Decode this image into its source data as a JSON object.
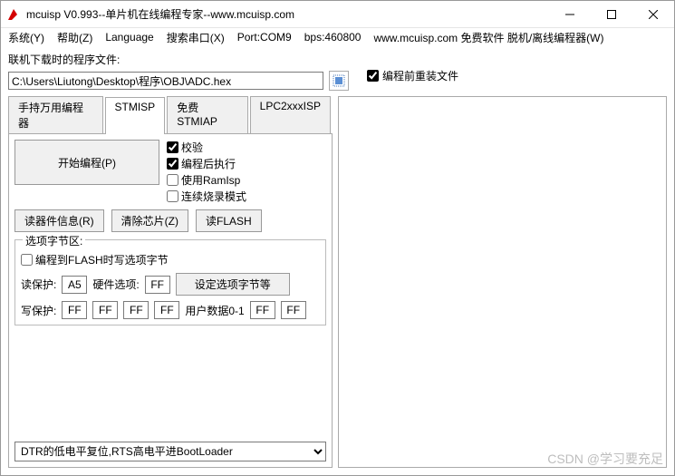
{
  "title": "mcuisp V0.993--单片机在线编程专家--www.mcuisp.com",
  "menu": {
    "system": "系统(Y)",
    "help": "帮助(Z)",
    "language": "Language",
    "search_port": "搜索串口(X)",
    "port": "Port:COM9",
    "bps": "bps:460800",
    "site": "www.mcuisp.com 免费软件 脱机/离线编程器(W)"
  },
  "path_label": "联机下载时的程序文件:",
  "path_value": "C:\\Users\\Liutong\\Desktop\\程序\\OBJ\\ADC.hex",
  "reload_label": "编程前重装文件",
  "tabs": {
    "t0": "手持万用编程器",
    "t1": "STMISP",
    "t2": "免费STMIAP",
    "t3": "LPC2xxxISP"
  },
  "btn_program": "开始编程(P)",
  "checks": {
    "verify": "校验",
    "run_after": "编程后执行",
    "ramisp": "使用RamIsp",
    "continuous": "连续烧录模式"
  },
  "btns": {
    "chip_info": "读器件信息(R)",
    "erase": "清除芯片(Z)",
    "read_flash": "读FLASH"
  },
  "opt": {
    "group_title": "选项字节区:",
    "write_opt": "编程到FLASH时写选项字节",
    "read_protect": "读保护:",
    "hw_opt": "硬件选项:",
    "set_opt": "设定选项字节等",
    "write_protect": "写保护:",
    "user_data": "用户数据0-1",
    "rp_val": "A5",
    "hw_val": "FF",
    "wp0": "FF",
    "wp1": "FF",
    "wp2": "FF",
    "wp3": "FF",
    "ud0": "FF",
    "ud1": "FF"
  },
  "combo": "DTR的低电平复位,RTS高电平进BootLoader",
  "watermark": "CSDN @学习要充足"
}
